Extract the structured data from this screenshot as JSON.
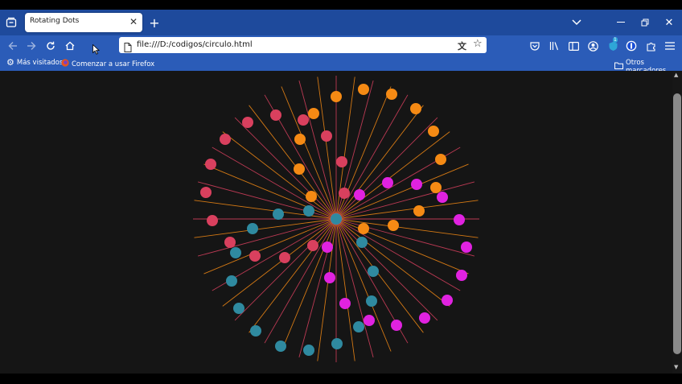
{
  "browser": {
    "tab_title": "Rotating Dots",
    "url": "file:///D:/codigos/circulo.html",
    "bookmarks": [
      {
        "label": "Más visitados",
        "icon": "gear-icon"
      },
      {
        "label": "Comenzar a usar Firefox",
        "icon": "firefox-icon"
      }
    ],
    "other_bookmarks": "Otros marcadores",
    "extension_badge": "1"
  },
  "colors": {
    "tabbar": "#1e4a9c",
    "navbar": "#2b5cb8",
    "canvas_bg": "#151515",
    "dot_red": "#d9405e",
    "dot_orange": "#f58a14",
    "dot_magenta": "#e022e0",
    "dot_teal": "#2f8aa0"
  }
}
